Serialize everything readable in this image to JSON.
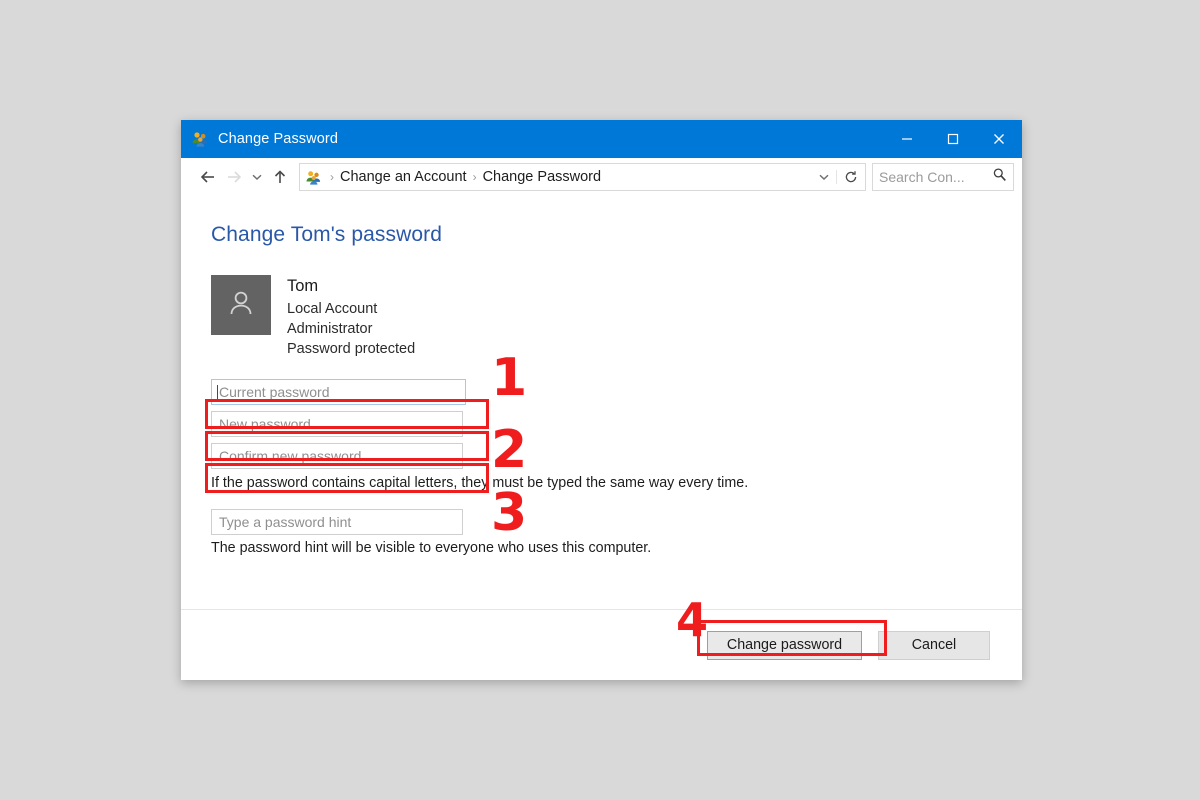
{
  "window": {
    "title": "Change Password",
    "title_icon": "users-icon",
    "controls": {
      "minimize": "–",
      "maximize": "□",
      "close": "✕"
    }
  },
  "addressbar": {
    "back_icon": "back-arrow-icon",
    "forward_icon": "forward-arrow-icon",
    "recent_icon": "chevron-down-icon",
    "up_icon": "up-arrow-icon",
    "breadcrumb_icon": "users-icon",
    "breadcrumb": [
      "Change an Account",
      "Change Password"
    ],
    "separator": "›",
    "dropdown_icon": "chevron-down-icon",
    "refresh_icon": "refresh-icon",
    "search_placeholder": "Search Con...",
    "search_icon": "search-icon"
  },
  "content": {
    "page_title": "Change Tom's password",
    "account": {
      "avatar_icon": "person-icon",
      "name": "Tom",
      "account_type": "Local Account",
      "role": "Administrator",
      "password_status": "Password protected"
    },
    "fields": [
      {
        "name": "current-password",
        "placeholder": "Current password",
        "focused": true
      },
      {
        "name": "new-password",
        "placeholder": "New password",
        "focused": false
      },
      {
        "name": "confirm-new-password",
        "placeholder": "Confirm new password",
        "focused": false
      }
    ],
    "capital_letters_note": "If the password contains capital letters, they must be typed the same way every time.",
    "hint_placeholder": "Type a password hint",
    "hint_note": "The password hint will be visible to everyone who uses this computer."
  },
  "footer": {
    "change_password_label": "Change password",
    "cancel_label": "Cancel"
  },
  "annotations": {
    "color": "#ef1d1d",
    "steps": [
      "1",
      "2",
      "3",
      "4"
    ]
  },
  "colors": {
    "titlebar": "#0078d7",
    "page_background": "#d9d9d9",
    "heading": "#2a58a8",
    "avatar": "#636363",
    "annotation_red": "#ef1d1d"
  }
}
